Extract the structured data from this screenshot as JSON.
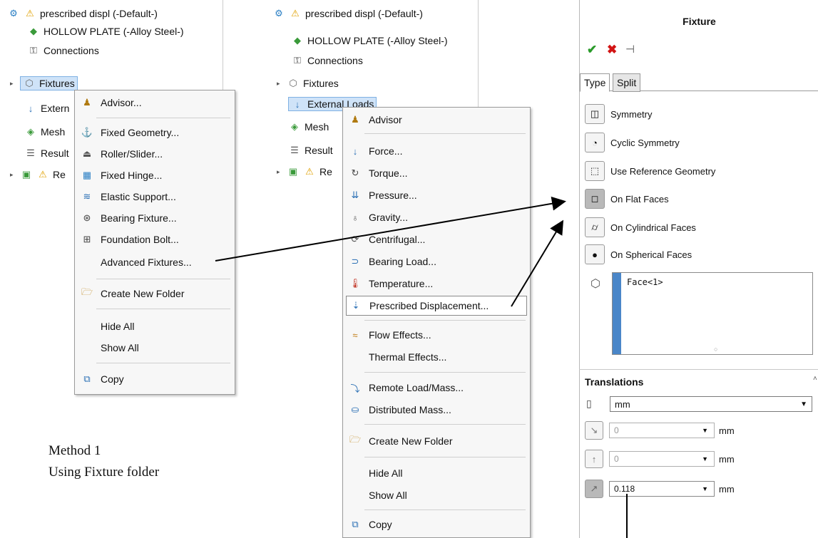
{
  "tree1": {
    "study": "prescribed displ (-Default-)",
    "part": "HOLLOW PLATE (-Alloy Steel-)",
    "connections": "Connections",
    "fixtures": "Fixtures",
    "external": "Extern",
    "mesh": "Mesh",
    "result": "Result",
    "report": "Re"
  },
  "menu1": {
    "advisor": "Advisor...",
    "fixed_geometry": "Fixed Geometry...",
    "roller_slider": "Roller/Slider...",
    "fixed_hinge": "Fixed Hinge...",
    "elastic_support": "Elastic Support...",
    "bearing_fixture": "Bearing Fixture...",
    "foundation_bolt": "Foundation Bolt...",
    "advanced_fixtures": "Advanced Fixtures...",
    "create_folder": "Create New Folder",
    "hide_all": "Hide All",
    "show_all": "Show All",
    "copy": "Copy"
  },
  "tree2": {
    "study": "prescribed displ (-Default-)",
    "part": "HOLLOW PLATE (-Alloy Steel-)",
    "connections": "Connections",
    "fixtures": "Fixtures",
    "external": "External Loads",
    "mesh": "Mesh",
    "result": "Result",
    "report": "Re"
  },
  "menu2": {
    "advisor": "Advisor",
    "force": "Force...",
    "torque": "Torque...",
    "pressure": "Pressure...",
    "gravity": "Gravity...",
    "centrifugal": "Centrifugal...",
    "bearing_load": "Bearing Load...",
    "temperature": "Temperature...",
    "prescribed": "Prescribed Displacement...",
    "flow": "Flow Effects...",
    "thermal": "Thermal Effects...",
    "remote": "Remote Load/Mass...",
    "distributed": "Distributed Mass...",
    "create_folder": "Create New Folder",
    "hide_all": "Hide All",
    "show_all": "Show All",
    "copy": "Copy"
  },
  "caption": {
    "line1": "Method 1",
    "line2": "Using Fixture folder"
  },
  "pm": {
    "title": "Fixture",
    "tab_type": "Type",
    "tab_split": "Split",
    "symmetry": "Symmetry",
    "cyclic": "Cyclic Symmetry",
    "reference": "Use Reference Geometry",
    "flat": "On Flat Faces",
    "cylindrical": "On Cylindrical Faces",
    "spherical": "On Spherical Faces",
    "selection": "Face<1>",
    "translations": "Translations",
    "unit": "mm",
    "t1_value": "0",
    "t2_value": "0",
    "t3_value": "0.118",
    "field_unit": "mm"
  },
  "colors": {
    "accent": "#4a86c8",
    "ok": "#2a9a2a",
    "cancel": "#d21414",
    "highlight": "#cfe3f8"
  }
}
